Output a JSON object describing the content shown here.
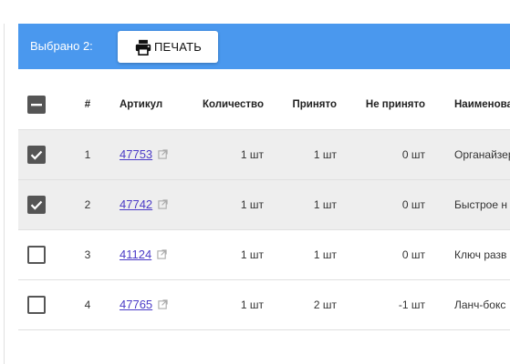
{
  "selection_bar": {
    "selected_text": "Выбрано 2:",
    "print_label": "ПЕЧАТЬ",
    "bg_color": "#4a98ee"
  },
  "table": {
    "columns": [
      "#",
      "Артикул",
      "Количество",
      "Принято",
      "Не принято",
      "Наименование"
    ],
    "header_checkbox_state": "indeterminate",
    "rows": [
      {
        "checked": true,
        "num": "1",
        "article": "47753",
        "qty": "1 шт",
        "accepted": "1 шт",
        "not_accepted": "0 шт",
        "name": "Органайзер"
      },
      {
        "checked": true,
        "num": "2",
        "article": "47742",
        "qty": "1 шт",
        "accepted": "1 шт",
        "not_accepted": "0 шт",
        "name": "Быстрое н"
      },
      {
        "checked": false,
        "num": "3",
        "article": "41124",
        "qty": "1 шт",
        "accepted": "1 шт",
        "not_accepted": "0 шт",
        "name": "Ключ разв"
      },
      {
        "checked": false,
        "num": "4",
        "article": "47765",
        "qty": "1 шт",
        "accepted": "2 шт",
        "not_accepted": "-1 шт",
        "name": "Ланч-бокс"
      }
    ]
  },
  "icons": {
    "print": "printer-icon",
    "external": "external-link-icon",
    "checkbox": "checkbox-icon"
  }
}
